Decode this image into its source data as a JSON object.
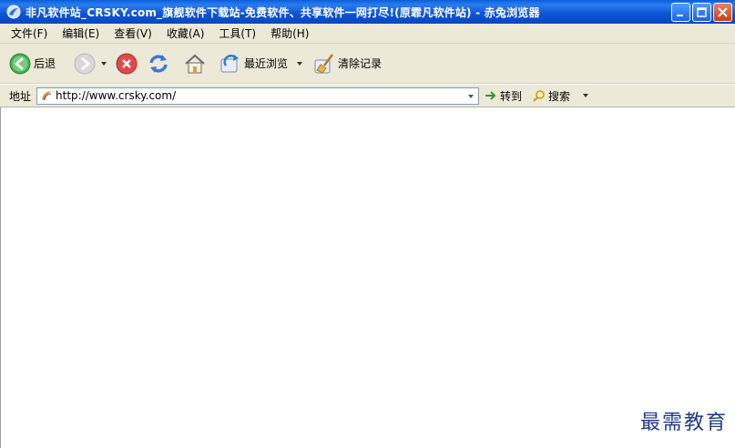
{
  "window": {
    "title": "非凡软件站_CRSKY.com_旗舰软件下载站-免费软件、共享软件一网打尽!(原霏凡软件站) - 赤兔浏览器"
  },
  "menu": [
    {
      "label": "文件(F)"
    },
    {
      "label": "编辑(E)"
    },
    {
      "label": "查看(V)"
    },
    {
      "label": "收藏(A)"
    },
    {
      "label": "工具(T)"
    },
    {
      "label": "帮助(H)"
    }
  ],
  "toolbar": {
    "back_label": "后退",
    "recent_label": "最近浏览",
    "clear_label": "清除记录"
  },
  "address": {
    "label": "地址",
    "url": "http://www.crsky.com/",
    "go_label": "转到",
    "search_label": "搜索"
  },
  "watermark": "最需教育",
  "colors": {
    "titlebar": "#0b54d4",
    "chrome": "#ece9d8",
    "go_arrow": "#2a9d2a"
  }
}
